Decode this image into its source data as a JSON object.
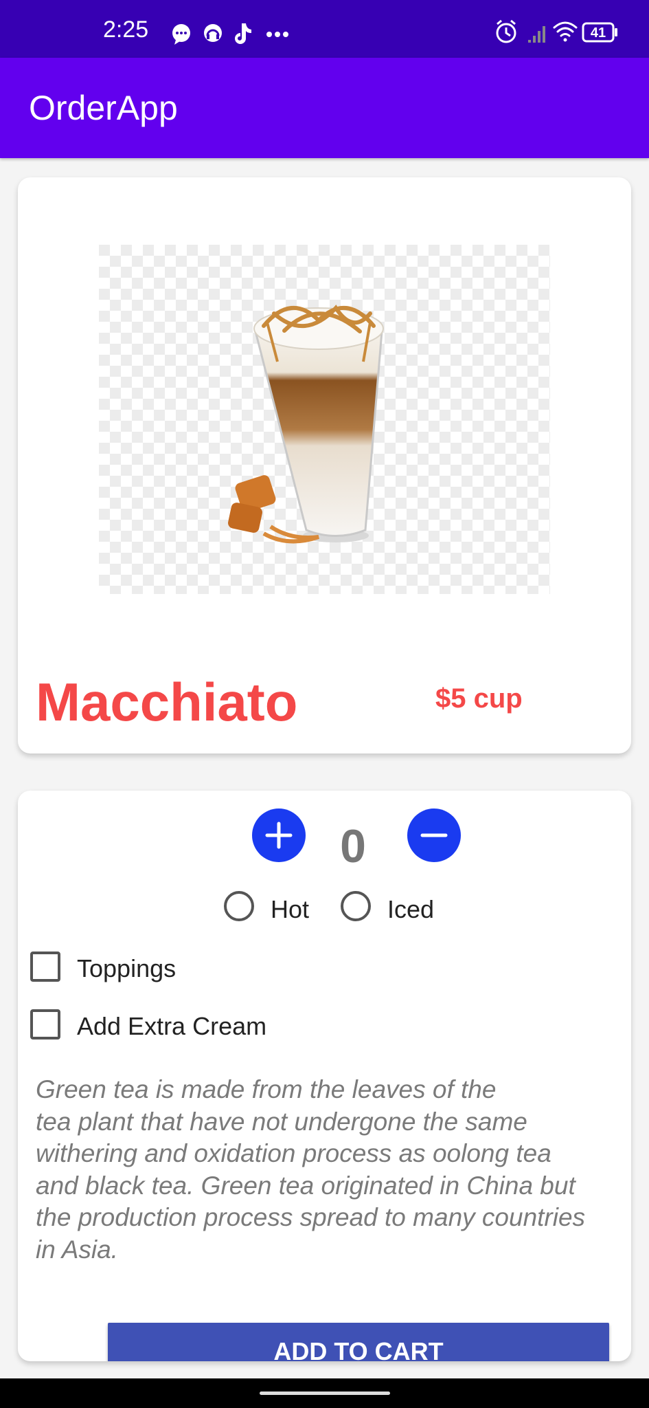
{
  "status_bar": {
    "time": "2:25",
    "battery": "41",
    "left_icons": [
      "chat-icon",
      "headset-app-icon",
      "tiktok-icon",
      "more-dots-icon"
    ],
    "right_icons": [
      "alarm-icon",
      "signal-icon",
      "wifi-icon",
      "battery-icon"
    ]
  },
  "app_bar": {
    "title": "OrderApp"
  },
  "colors": {
    "status_bar": "#3700b3",
    "app_bar": "#6200ee",
    "accent_red": "#f44848",
    "round_button": "#1a3bf0",
    "cart_button": "#3f51b5"
  },
  "product": {
    "image": "macchiato-glass-image",
    "name": "Macchiato",
    "price": "$5 cup"
  },
  "order": {
    "quantity": "0",
    "plus_icon": "plus-icon",
    "minus_icon": "minus-icon",
    "temperature_options": [
      {
        "label": "Hot",
        "selected": false
      },
      {
        "label": "Iced",
        "selected": false
      }
    ],
    "extras": [
      {
        "label": "Toppings",
        "checked": false
      },
      {
        "label": "Add Extra Cream",
        "checked": false
      }
    ],
    "description": "Green tea is made from the leaves of the\ntea plant that have not undergone the same\nwithering and oxidation process as oolong tea\nand black tea. Green tea originated in China but\nthe production process spread to many countries\nin Asia.",
    "cart_button_label": "ADD TO CART"
  }
}
